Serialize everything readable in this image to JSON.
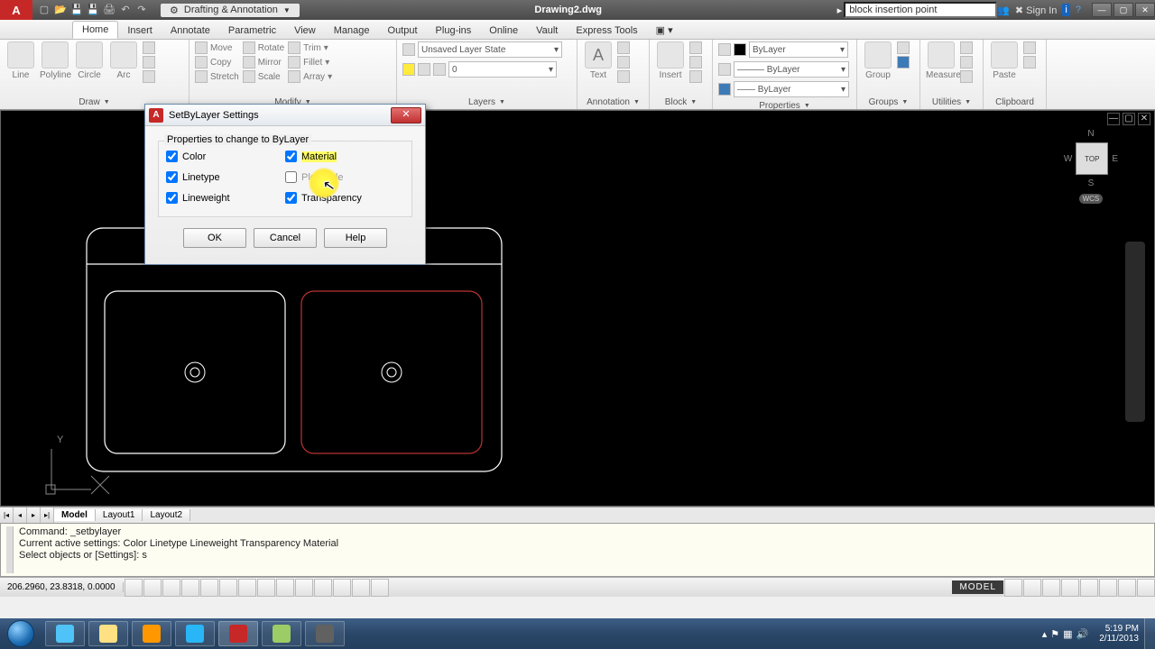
{
  "title": {
    "workspace": "Drafting & Annotation",
    "document": "Drawing2.dwg",
    "search": "block insertion point",
    "signin": "Sign In"
  },
  "ribbon_tabs": [
    "Home",
    "Insert",
    "Annotate",
    "Parametric",
    "View",
    "Manage",
    "Output",
    "Plug-ins",
    "Online",
    "Vault",
    "Express Tools"
  ],
  "panels": {
    "draw": {
      "title": "Draw",
      "line": "Line",
      "polyline": "Polyline",
      "circle": "Circle",
      "arc": "Arc"
    },
    "modify": {
      "title": "Modify",
      "move": "Move",
      "rotate": "Rotate",
      "trim": "Trim",
      "copy": "Copy",
      "mirror": "Mirror",
      "fillet": "Fillet",
      "stretch": "Stretch",
      "scale": "Scale",
      "array": "Array"
    },
    "layers": {
      "title": "Layers",
      "state": "Unsaved Layer State",
      "current": "0"
    },
    "annotation": {
      "title": "Annotation",
      "text": "Text"
    },
    "block": {
      "title": "Block",
      "insert": "Insert"
    },
    "properties": {
      "title": "Properties",
      "c1": "ByLayer",
      "c2": "ByLayer",
      "c3": "ByLayer"
    },
    "groups": {
      "title": "Groups",
      "group": "Group"
    },
    "utilities": {
      "title": "Utilities",
      "measure": "Measure"
    },
    "clipboard": {
      "title": "Clipboard",
      "paste": "Paste"
    }
  },
  "dialog": {
    "title": "SetByLayer Settings",
    "group_label": "Properties to change to ByLayer",
    "col1": [
      "Color",
      "Linetype",
      "Lineweight"
    ],
    "col2": [
      "Material",
      "Plot Style",
      "Transparency"
    ],
    "ok": "OK",
    "cancel": "Cancel",
    "help": "Help"
  },
  "viewcube": {
    "n": "N",
    "s": "S",
    "e": "E",
    "w": "W",
    "face": "TOP",
    "wcs": "WCS"
  },
  "layout_tabs": [
    "Model",
    "Layout1",
    "Layout2"
  ],
  "command_text": "Command: _setbylayer\nCurrent active settings: Color Linetype Lineweight Transparency Material\nSelect objects or [Settings]: s",
  "status": {
    "coords": "206.2960, 23.8318, 0.0000",
    "space": "MODEL"
  },
  "tray": {
    "time": "5:19 PM",
    "date": "2/11/2013"
  }
}
